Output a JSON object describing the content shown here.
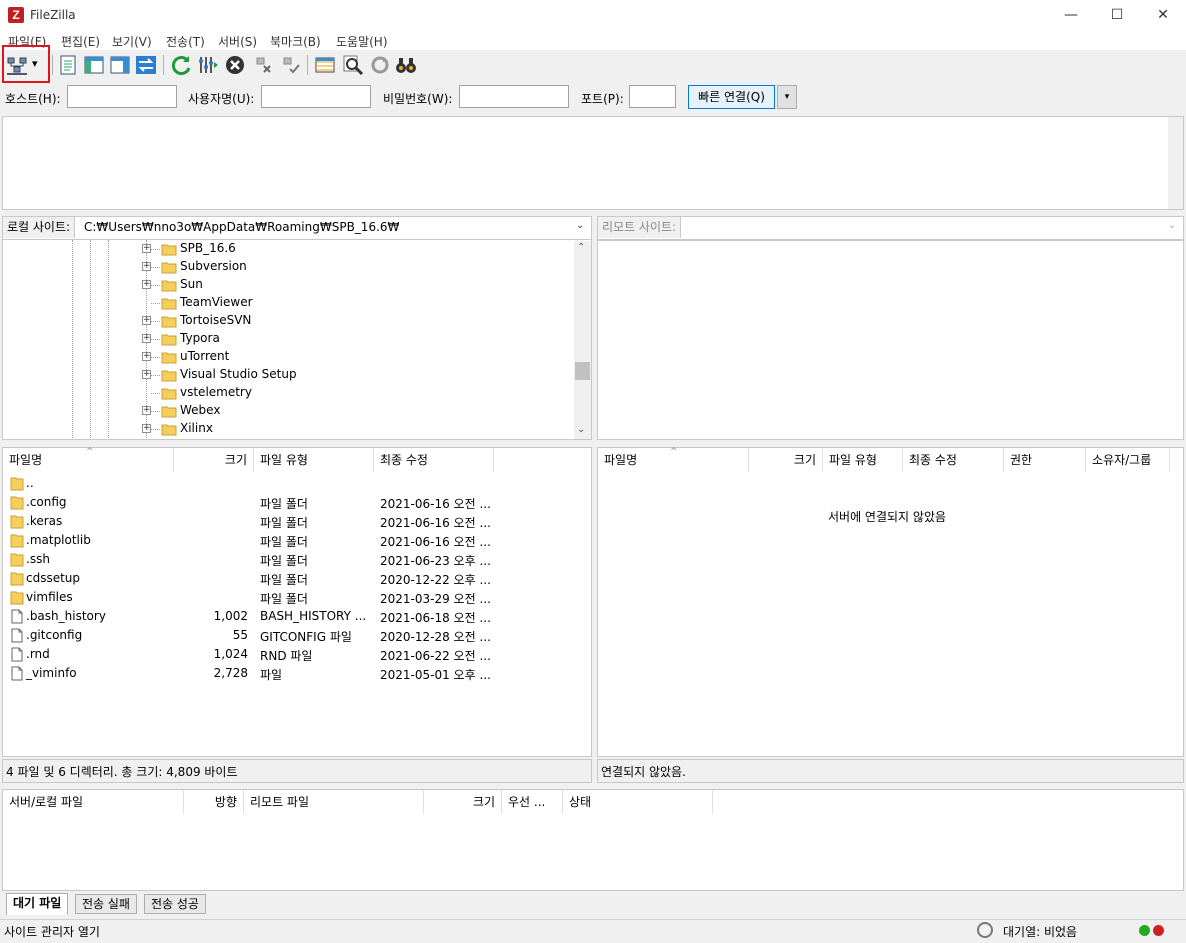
{
  "window": {
    "title": "FileZilla",
    "app_icon_letter": "Z",
    "minimize": "—",
    "maximize": "☐",
    "close": "✕"
  },
  "menu": [
    "파일(F)",
    "편집(E)",
    "보기(V)",
    "전송(T)",
    "서버(S)",
    "북마크(B)",
    "도움말(H)"
  ],
  "toolbar": {
    "site_manager_icon": "site-manager-icon",
    "dropdown_arrow": "▾"
  },
  "quickconnect": {
    "host_label": "호스트(H):",
    "user_label": "사용자명(U):",
    "pass_label": "비밀번호(W):",
    "port_label": "포트(P):",
    "button_label": "빠른 연결(Q)",
    "host_value": "",
    "user_value": "",
    "pass_value": "",
    "port_value": "",
    "dropdown_arrow": "▾"
  },
  "local": {
    "site_label": "로컬 사이트:",
    "path": "C:₩Users₩nno3o₩AppData₩Roaming₩SPB_16.6₩",
    "tree": [
      {
        "label": "SPB_16.6",
        "expandable": true
      },
      {
        "label": "Subversion",
        "expandable": true
      },
      {
        "label": "Sun",
        "expandable": true
      },
      {
        "label": "TeamViewer",
        "expandable": false
      },
      {
        "label": "TortoiseSVN",
        "expandable": true
      },
      {
        "label": "Typora",
        "expandable": true
      },
      {
        "label": "uTorrent",
        "expandable": true
      },
      {
        "label": "Visual Studio Setup",
        "expandable": true
      },
      {
        "label": "vstelemetry",
        "expandable": false
      },
      {
        "label": "Webex",
        "expandable": true
      },
      {
        "label": "Xilinx",
        "expandable": true
      }
    ],
    "columns": {
      "name": "파일명",
      "size": "크기",
      "type": "파일 유형",
      "modified": "최종 수정"
    },
    "files": [
      {
        "name": "..",
        "size": "",
        "type": "",
        "modified": "",
        "kind": "folder"
      },
      {
        "name": ".config",
        "size": "",
        "type": "파일 폴더",
        "modified": "2021-06-16 오전 ...",
        "kind": "folder"
      },
      {
        "name": ".keras",
        "size": "",
        "type": "파일 폴더",
        "modified": "2021-06-16 오전 ...",
        "kind": "folder"
      },
      {
        "name": ".matplotlib",
        "size": "",
        "type": "파일 폴더",
        "modified": "2021-06-16 오전 ...",
        "kind": "folder"
      },
      {
        "name": ".ssh",
        "size": "",
        "type": "파일 폴더",
        "modified": "2021-06-23 오후 ...",
        "kind": "folder"
      },
      {
        "name": "cdssetup",
        "size": "",
        "type": "파일 폴더",
        "modified": "2020-12-22 오후 ...",
        "kind": "folder"
      },
      {
        "name": "vimfiles",
        "size": "",
        "type": "파일 폴더",
        "modified": "2021-03-29 오전 ...",
        "kind": "folder"
      },
      {
        "name": ".bash_history",
        "size": "1,002",
        "type": "BASH_HISTORY ...",
        "modified": "2021-06-18 오전 ...",
        "kind": "file"
      },
      {
        "name": ".gitconfig",
        "size": "55",
        "type": "GITCONFIG 파일",
        "modified": "2020-12-28 오전 ...",
        "kind": "file"
      },
      {
        "name": ".rnd",
        "size": "1,024",
        "type": "RND 파일",
        "modified": "2021-06-22 오전 ...",
        "kind": "file"
      },
      {
        "name": "_viminfo",
        "size": "2,728",
        "type": "파일",
        "modified": "2021-05-01 오후 ...",
        "kind": "file"
      }
    ],
    "status": "4 파일 및 6 디렉터리. 총 크기: 4,809 바이트"
  },
  "remote": {
    "site_label": "리모트 사이트:",
    "path": "",
    "columns": {
      "name": "파일명",
      "size": "크기",
      "type": "파일 유형",
      "modified": "최종 수정",
      "perms": "권한",
      "owner": "소유자/그룹"
    },
    "empty_message": "서버에 연결되지 않았음",
    "status": "연결되지 않았음."
  },
  "queue": {
    "columns": {
      "local_file": "서버/로컬 파일",
      "direction": "방향",
      "remote_file": "리모트 파일",
      "size": "크기",
      "priority": "우선 ...",
      "status": "상태"
    },
    "tabs": [
      "대기 파일",
      "전송 실패",
      "전송 성공"
    ]
  },
  "statusbar": {
    "text": "사이트 관리자 열기",
    "queue_status": "대기열: 비었음",
    "led_colors": [
      "#22aa22",
      "#cc2222"
    ]
  },
  "sort_arrow": "^"
}
